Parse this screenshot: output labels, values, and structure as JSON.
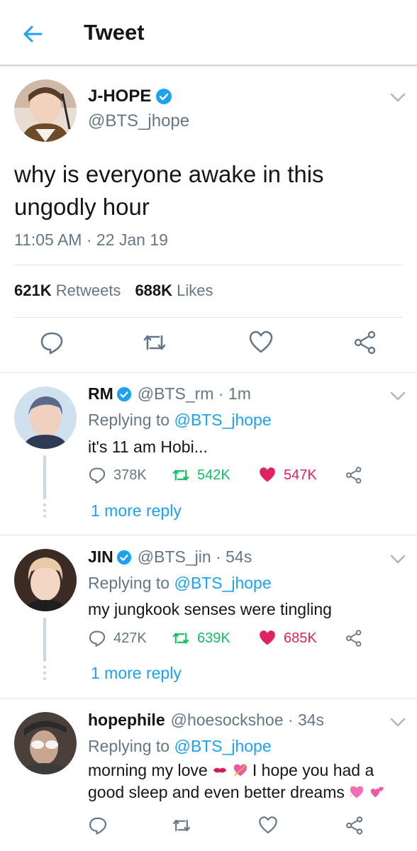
{
  "header": {
    "title": "Tweet"
  },
  "tweet": {
    "name": "J-HOPE",
    "handle": "@BTS_jhope",
    "text": "why is everyone awake in this ungodly hour",
    "time": "11:05 AM · 22 Jan 19",
    "retweets_count": "621K",
    "retweets_label": "Retweets",
    "likes_count": "688K",
    "likes_label": "Likes"
  },
  "replies": [
    {
      "name": "RM",
      "handle": "@BTS_rm · 1m",
      "replying_prefix": "Replying to ",
      "replying_to": "@BTS_jhope",
      "text": "it's 11 am Hobi...",
      "replies": "378K",
      "retweets": "542K",
      "likes": "547K",
      "more": "1 more reply"
    },
    {
      "name": "JIN",
      "handle": "@BTS_jin · 54s",
      "replying_prefix": "Replying to ",
      "replying_to": "@BTS_jhope",
      "text": "my jungkook senses were tingling",
      "replies": "427K",
      "retweets": "639K",
      "likes": "685K",
      "more": "1 more reply"
    },
    {
      "name": "hopephile",
      "handle": "@hoesockshoe · 34s",
      "replying_prefix": "Replying to ",
      "replying_to": "@BTS_jhope",
      "text_line1": "morning my love",
      "text_line1_after": "I hope you had a",
      "text_line2": "good sleep and even better dreams"
    }
  ],
  "colors": {
    "accent": "#1da1f2",
    "retweet_green": "#17bf63",
    "like_red": "#e0245e",
    "muted": "#657786"
  }
}
